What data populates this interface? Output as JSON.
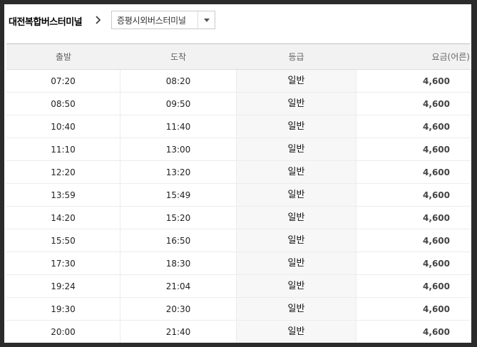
{
  "route": {
    "origin": "대전복합버스터미널",
    "destination": "증평시외버스터미널"
  },
  "table": {
    "headers": [
      "출발",
      "도착",
      "등급",
      "요금(어른)"
    ],
    "rows": [
      {
        "depart": "07:20",
        "arrive": "08:20",
        "grade": "일반",
        "fare": "4,600"
      },
      {
        "depart": "08:50",
        "arrive": "09:50",
        "grade": "일반",
        "fare": "4,600"
      },
      {
        "depart": "10:40",
        "arrive": "11:40",
        "grade": "일반",
        "fare": "4,600"
      },
      {
        "depart": "11:10",
        "arrive": "13:00",
        "grade": "일반",
        "fare": "4,600"
      },
      {
        "depart": "12:20",
        "arrive": "13:20",
        "grade": "일반",
        "fare": "4,600"
      },
      {
        "depart": "13:59",
        "arrive": "15:49",
        "grade": "일반",
        "fare": "4,600"
      },
      {
        "depart": "14:20",
        "arrive": "15:20",
        "grade": "일반",
        "fare": "4,600"
      },
      {
        "depart": "15:50",
        "arrive": "16:50",
        "grade": "일반",
        "fare": "4,600"
      },
      {
        "depart": "17:30",
        "arrive": "18:30",
        "grade": "일반",
        "fare": "4,600"
      },
      {
        "depart": "19:24",
        "arrive": "21:04",
        "grade": "일반",
        "fare": "4,600"
      },
      {
        "depart": "19:30",
        "arrive": "20:30",
        "grade": "일반",
        "fare": "4,600"
      },
      {
        "depart": "20:00",
        "arrive": "21:40",
        "grade": "일반",
        "fare": "4,600"
      }
    ]
  }
}
